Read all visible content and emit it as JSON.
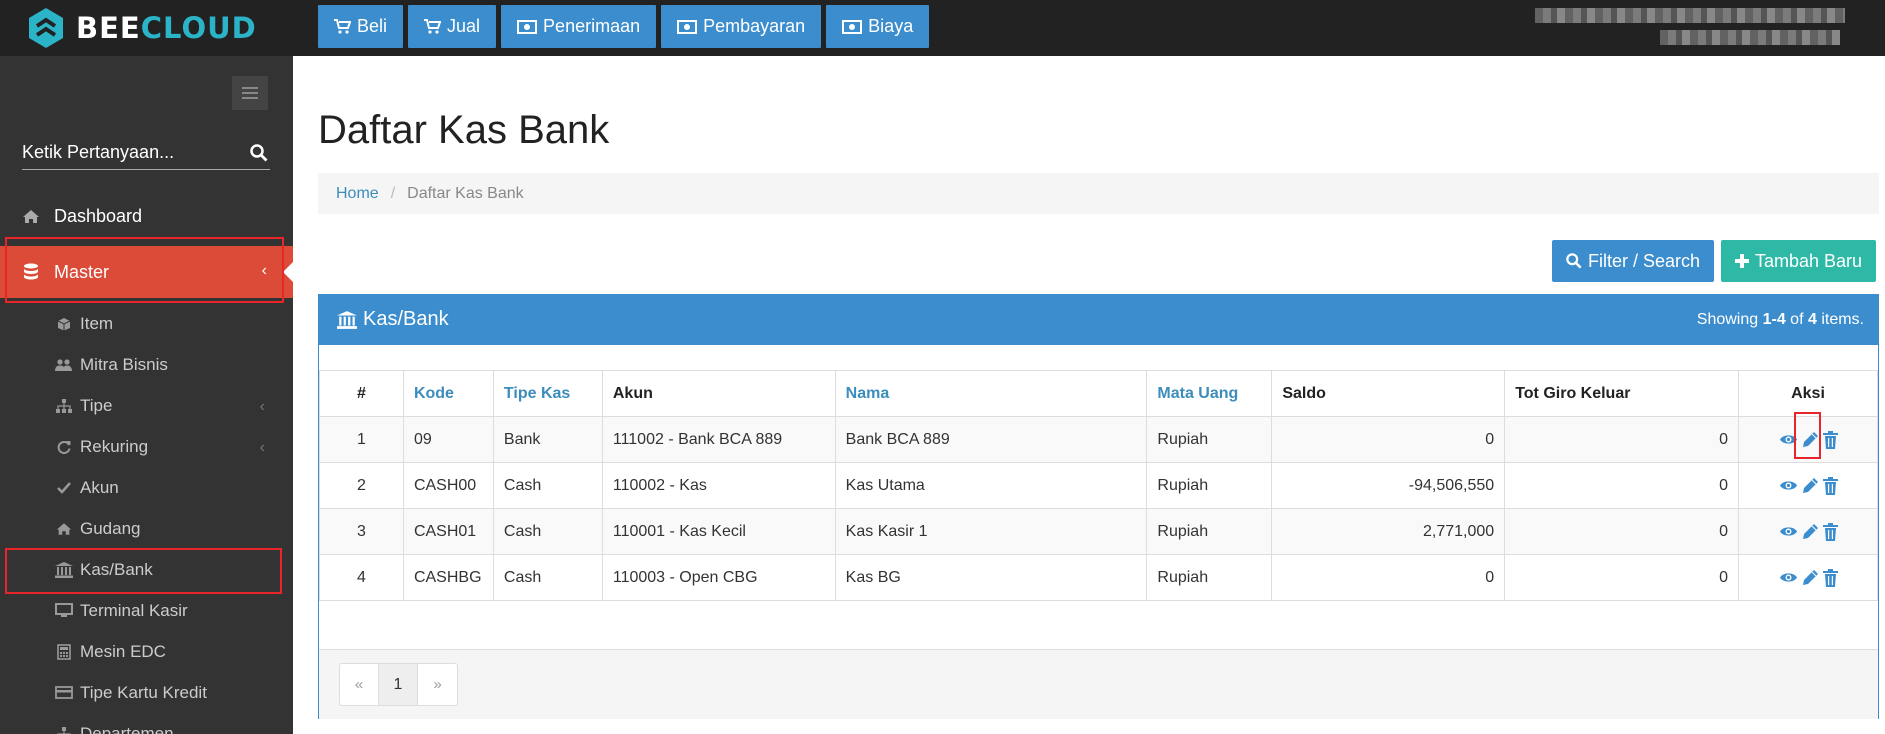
{
  "brand": {
    "name_part1": "BEE",
    "name_part2": "CLOUD"
  },
  "topnav": [
    {
      "label": "Beli",
      "icon": "cart-icon"
    },
    {
      "label": "Jual",
      "icon": "cart-icon"
    },
    {
      "label": "Penerimaan",
      "icon": "money-icon"
    },
    {
      "label": "Pembayaran",
      "icon": "money-icon"
    },
    {
      "label": "Biaya",
      "icon": "money-icon"
    }
  ],
  "sidebar": {
    "search_placeholder": "Ketik Pertanyaan...",
    "items": [
      {
        "label": "Dashboard",
        "icon": "home-icon"
      },
      {
        "label": "Master",
        "icon": "database-icon",
        "active": true
      }
    ],
    "sub_items": [
      {
        "label": "Item",
        "icon": "cube-icon"
      },
      {
        "label": "Mitra Bisnis",
        "icon": "users-icon"
      },
      {
        "label": "Tipe",
        "icon": "sitemap-icon"
      },
      {
        "label": "Rekuring",
        "icon": "refresh-icon"
      },
      {
        "label": "Akun",
        "icon": "check-icon"
      },
      {
        "label": "Gudang",
        "icon": "home-icon"
      },
      {
        "label": "Kas/Bank",
        "icon": "bank-icon"
      },
      {
        "label": "Terminal Kasir",
        "icon": "monitor-icon"
      },
      {
        "label": "Mesin EDC",
        "icon": "calculator-icon"
      },
      {
        "label": "Tipe Kartu Kredit",
        "icon": "credit-card-icon"
      },
      {
        "label": "Departemen",
        "icon": "sitemap-icon"
      }
    ]
  },
  "page": {
    "title": "Daftar Kas Bank",
    "breadcrumb": {
      "home": "Home",
      "current": "Daftar Kas Bank"
    },
    "buttons": {
      "filter": "Filter / Search",
      "add": "Tambah Baru"
    }
  },
  "panel": {
    "title": "Kas/Bank",
    "summary": {
      "prefix": "Showing ",
      "range": "1-4",
      "mid": " of ",
      "total": "4",
      "suffix": " items."
    }
  },
  "table": {
    "headers": [
      "#",
      "Kode",
      "Tipe Kas",
      "Akun",
      "Nama",
      "Mata Uang",
      "Saldo",
      "Tot Giro Keluar",
      "Aksi"
    ],
    "rows": [
      {
        "no": "1",
        "kode": "09",
        "tipe": "Bank",
        "akun": "111002 - Bank BCA 889",
        "nama": "Bank BCA 889",
        "mata_uang": "Rupiah",
        "saldo": "0",
        "giro": "0"
      },
      {
        "no": "2",
        "kode": "CASH00",
        "tipe": "Cash",
        "akun": "110002 - Kas",
        "nama": "Kas Utama",
        "mata_uang": "Rupiah",
        "saldo": "-94,506,550",
        "giro": "0"
      },
      {
        "no": "3",
        "kode": "CASH01",
        "tipe": "Cash",
        "akun": "110001 - Kas Kecil",
        "nama": "Kas Kasir 1",
        "mata_uang": "Rupiah",
        "saldo": "2,771,000",
        "giro": "0"
      },
      {
        "no": "4",
        "kode": "CASHBG",
        "tipe": "Cash",
        "akun": "110003 - Open CBG",
        "nama": "Kas BG",
        "mata_uang": "Rupiah",
        "saldo": "0",
        "giro": "0"
      }
    ]
  },
  "pagination": {
    "prev": "«",
    "current": "1",
    "next": "»"
  },
  "colors": {
    "primary": "#3c8dcd",
    "success": "#2eb8a6",
    "active": "#dc4a38",
    "highlight": "#e8262a"
  }
}
